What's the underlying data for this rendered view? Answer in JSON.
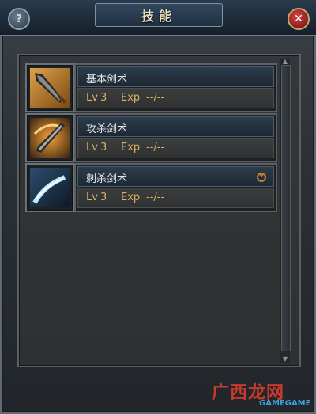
{
  "window": {
    "title": "技能",
    "help_label": "?",
    "close_label": "✕"
  },
  "skills": [
    {
      "name": "基本剑术",
      "lv_label": "Lv",
      "lv": "3",
      "exp_label": "Exp",
      "exp": "--/--",
      "icon": "sword-icon"
    },
    {
      "name": "攻杀剑术",
      "lv_label": "Lv",
      "lv": "3",
      "exp_label": "Exp",
      "exp": "--/--",
      "icon": "slash-sword-icon"
    },
    {
      "name": "刺杀剑术",
      "lv_label": "Lv",
      "lv": "3",
      "exp_label": "Exp",
      "exp": "--/--",
      "icon": "thrust-sword-icon",
      "badge": "status-badge-icon"
    }
  ],
  "watermark": {
    "text": "广西龙网",
    "sub": "GAMEGAME"
  },
  "colors": {
    "accent_gold": "#d8b35e",
    "close_red": "#d04444"
  }
}
